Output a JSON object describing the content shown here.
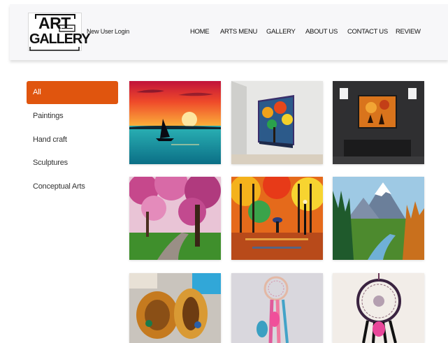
{
  "brand": {
    "logo_line1": "ART",
    "logo_line2": "GALLERY"
  },
  "user_links": {
    "new_user": "New User",
    "login": "Login"
  },
  "nav": [
    "HOME",
    "ARTS MENU",
    "GALLERY",
    "ABOUT US",
    "CONTACT US",
    "REVIEW"
  ],
  "categories": [
    "All",
    "Paintings",
    "Hand craft",
    "Sculptures",
    "Conceptual Arts"
  ],
  "active_category": "All",
  "colors": {
    "accent": "#e0550e",
    "header_bg": "#f7f7f9"
  },
  "gallery_icons": [
    "sunset-sailboat-painting",
    "autumn-canvas-on-wall",
    "deer-painting-in-dark-room",
    "cherry-blossom-path-painting",
    "autumn-rain-walk-painting",
    "mountain-river-painting",
    "painted-bangles",
    "dreamcatcher-pink",
    "dreamcatcher-black"
  ]
}
